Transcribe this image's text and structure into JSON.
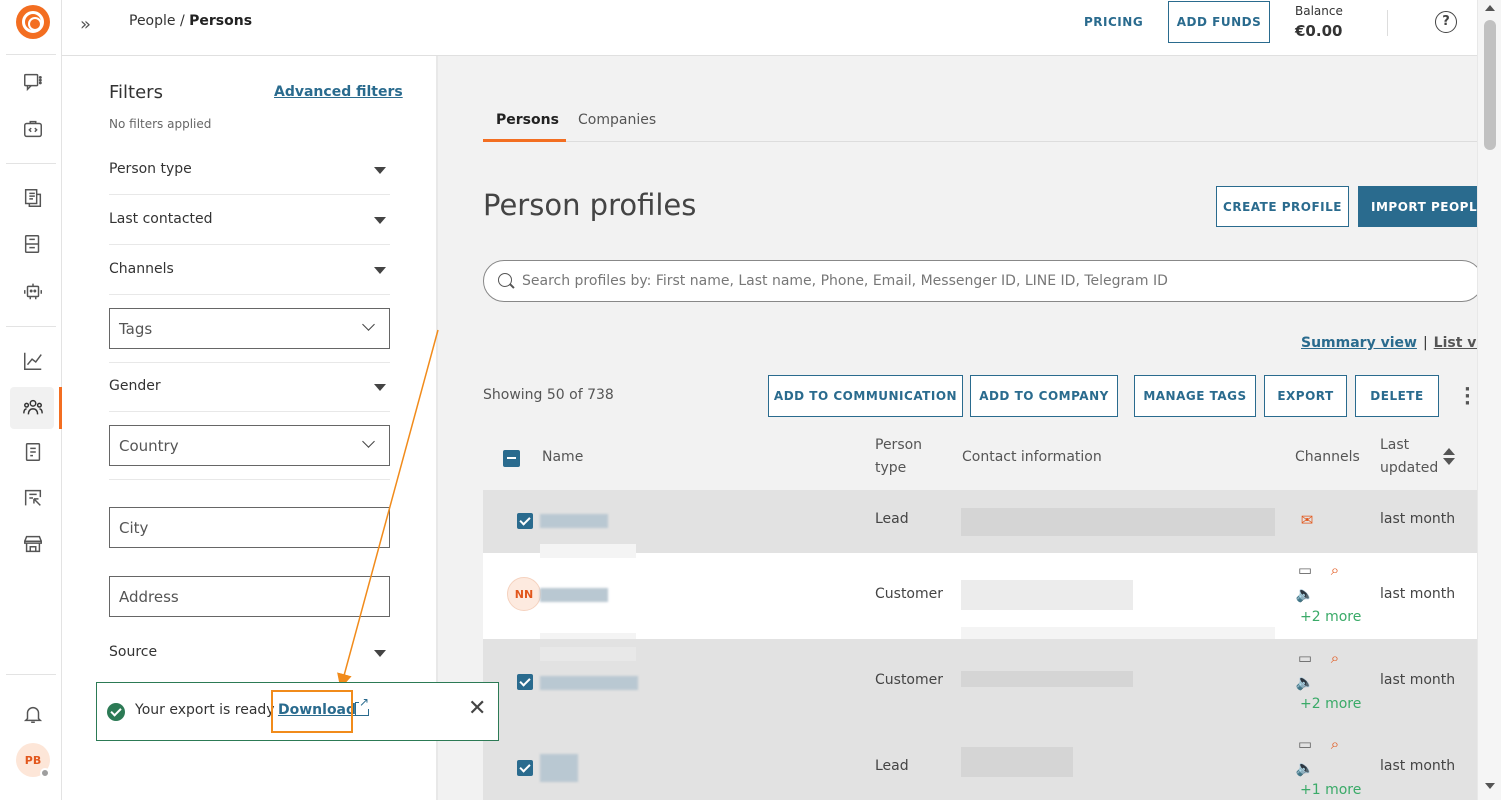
{
  "topbar": {
    "breadcrumb_parent": "People /",
    "breadcrumb_current": "Persons",
    "pricing": "PRICING",
    "add_funds": "ADD FUNDS",
    "balance_label": "Balance",
    "balance_value": "€0.00",
    "help": "?"
  },
  "rail": {
    "avatar_initials": "PB"
  },
  "filters": {
    "title": "Filters",
    "advanced_link": "Advanced filters",
    "status": "No filters applied",
    "person_type": "Person type",
    "last_contacted": "Last contacted",
    "channels": "Channels",
    "tags": "Tags",
    "gender": "Gender",
    "country": "Country",
    "city": "City",
    "address": "Address",
    "source": "Source"
  },
  "tabs": {
    "persons": "Persons",
    "companies": "Companies"
  },
  "main": {
    "title": "Person profiles",
    "create_profile": "CREATE PROFILE",
    "import_people": "IMPORT PEOPLE",
    "search_placeholder": "Search profiles by: First name, Last name, Phone, Email, Messenger ID, LINE ID, Telegram ID",
    "summary_view": "Summary view",
    "list_view": "List vie",
    "showing": "Showing 50 of 738",
    "add_to_communication": "ADD TO COMMUNICATION",
    "add_to_company": "ADD TO COMPANY",
    "manage_tags": "MANAGE TAGS",
    "export": "EXPORT",
    "delete": "DELETE"
  },
  "table": {
    "headers": {
      "name": "Name",
      "person_type_1": "Person",
      "person_type_2": "type",
      "contact": "Contact information",
      "channels": "Channels",
      "last_1": "Last",
      "last_2": "updated"
    },
    "rows": [
      {
        "type": "Lead",
        "updated": "last month",
        "more": ""
      },
      {
        "type": "Customer",
        "updated": "last month",
        "more": "+2 more",
        "initials": "NN"
      },
      {
        "type": "Customer",
        "updated": "last month",
        "more": "+2 more"
      },
      {
        "type": "Lead",
        "updated": "last month",
        "more": "+1 more"
      }
    ]
  },
  "toast": {
    "message": "Your export is ready",
    "download": "Download"
  },
  "colors": {
    "accent": "#f36e21",
    "primary": "#2a6b8e",
    "success": "#2c7a55",
    "more_link": "#3aaa68"
  }
}
